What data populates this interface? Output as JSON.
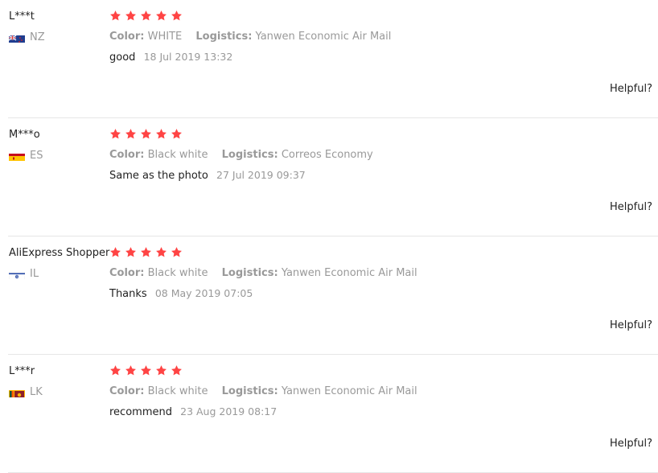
{
  "labels": {
    "color": "Color:",
    "logistics": "Logistics:",
    "helpful": "Helpful?"
  },
  "colors": {
    "star": "#f44444",
    "divider": "#e6e6e6"
  },
  "reviews": [
    {
      "user": "L***t",
      "country": "NZ",
      "flag_icon": "flag-nz-icon",
      "rating": 5,
      "color": "WHITE",
      "logistics": "Yanwen Economic Air Mail",
      "feedback": "good",
      "date": "18 Jul 2019 13:32"
    },
    {
      "user": "M***o",
      "country": "ES",
      "flag_icon": "flag-es-icon",
      "rating": 5,
      "color": "Black white",
      "logistics": "Correos Economy",
      "feedback": "Same as the photo",
      "date": "27 Jul 2019 09:37"
    },
    {
      "user": "AliExpress Shopper",
      "country": "IL",
      "flag_icon": "flag-il-icon",
      "rating": 5,
      "color": "Black white",
      "logistics": "Yanwen Economic Air Mail",
      "feedback": "Thanks",
      "date": "08 May 2019 07:05"
    },
    {
      "user": "L***r",
      "country": "LK",
      "flag_icon": "flag-lk-icon",
      "rating": 5,
      "color": "Black white",
      "logistics": "Yanwen Economic Air Mail",
      "feedback": "recommend",
      "date": "23 Aug 2019 08:17"
    }
  ]
}
